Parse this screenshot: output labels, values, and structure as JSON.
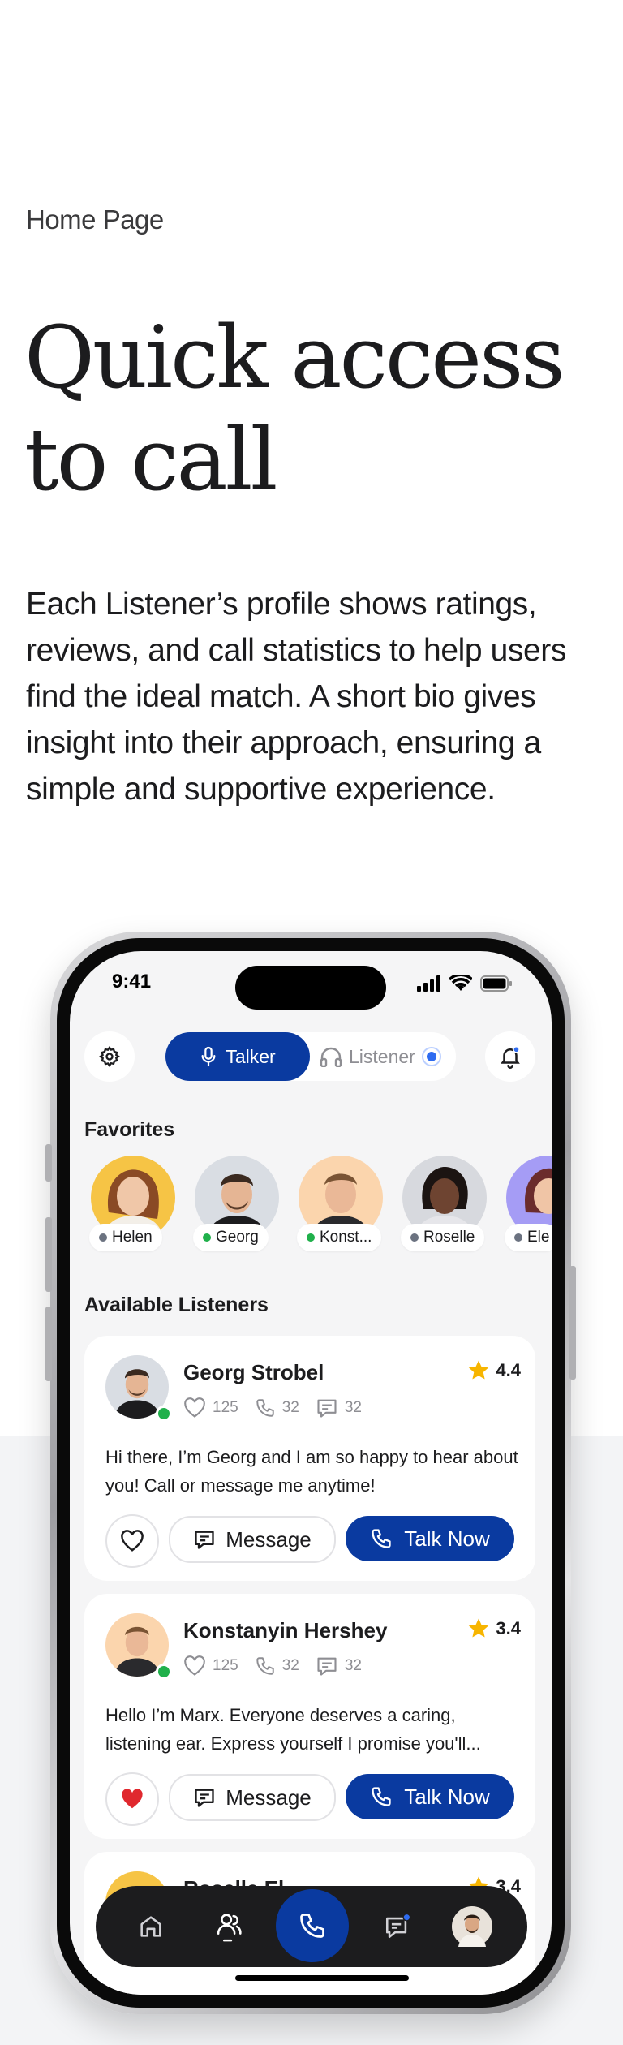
{
  "page": {
    "eyebrow": "Home Page",
    "headline_line1": "Quick access",
    "headline_line2": "to call",
    "body": "Each Listener’s profile shows ratings, reviews, and call statistics to help users find the ideal match. A short bio gives insight into their approach, ensuring a simple and supportive experience."
  },
  "status_bar": {
    "time": "9:41"
  },
  "header": {
    "talker_label": "Talker",
    "listener_label": "Listener"
  },
  "favorites": {
    "title": "Favorites",
    "items": [
      {
        "name": "Helen",
        "status_color": "#6b7280"
      },
      {
        "name": "Georg",
        "status_color": "#20b04b"
      },
      {
        "name": "Konst...",
        "status_color": "#20b04b"
      },
      {
        "name": "Roselle",
        "status_color": "#6b7280"
      },
      {
        "name": "Ele",
        "status_color": "#6b7280"
      }
    ]
  },
  "listeners": {
    "title": "Available Listeners",
    "cards": [
      {
        "name": "Georg Strobel",
        "rating": "4.4",
        "likes": "125",
        "calls": "32",
        "messages": "32",
        "bio": "Hi there, I’m Georg and I am so happy to hear about you! Call or message me anytime!",
        "favorited": false,
        "message_label": "Message",
        "talk_label": "Talk Now"
      },
      {
        "name": "Konstanyin Hershey",
        "rating": "3.4",
        "likes": "125",
        "calls": "32",
        "messages": "32",
        "bio": "Hello I’m Marx. Everyone deserves a caring, listening ear. Express yourself I promise you'll...",
        "favorited": true,
        "message_label": "Message",
        "talk_label": "Talk Now"
      },
      {
        "name": "Roselle El...",
        "rating": "3.4"
      }
    ]
  },
  "tabbar": {
    "items": [
      "home-icon",
      "listeners-icon",
      "call-icon",
      "messages-icon",
      "profile-avatar"
    ]
  },
  "colors": {
    "primary": "#0a3aa0",
    "star": "#f7b500",
    "online": "#20b04b",
    "heart_active": "#e0282e"
  }
}
